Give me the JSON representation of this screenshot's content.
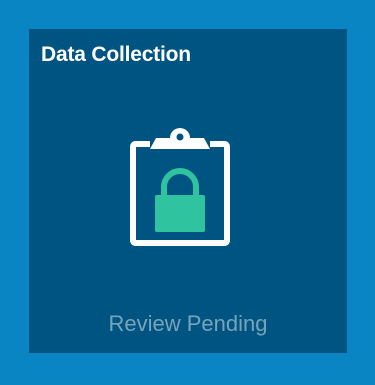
{
  "tile": {
    "title": "Data Collection",
    "status": "Review Pending",
    "icon": "clipboard-lock-icon"
  },
  "colors": {
    "background": "#0a85c3",
    "tile": "#005481",
    "icon_outline": "#ffffff",
    "lock": "#2fc3a0",
    "status_text": "#78a3ba"
  }
}
